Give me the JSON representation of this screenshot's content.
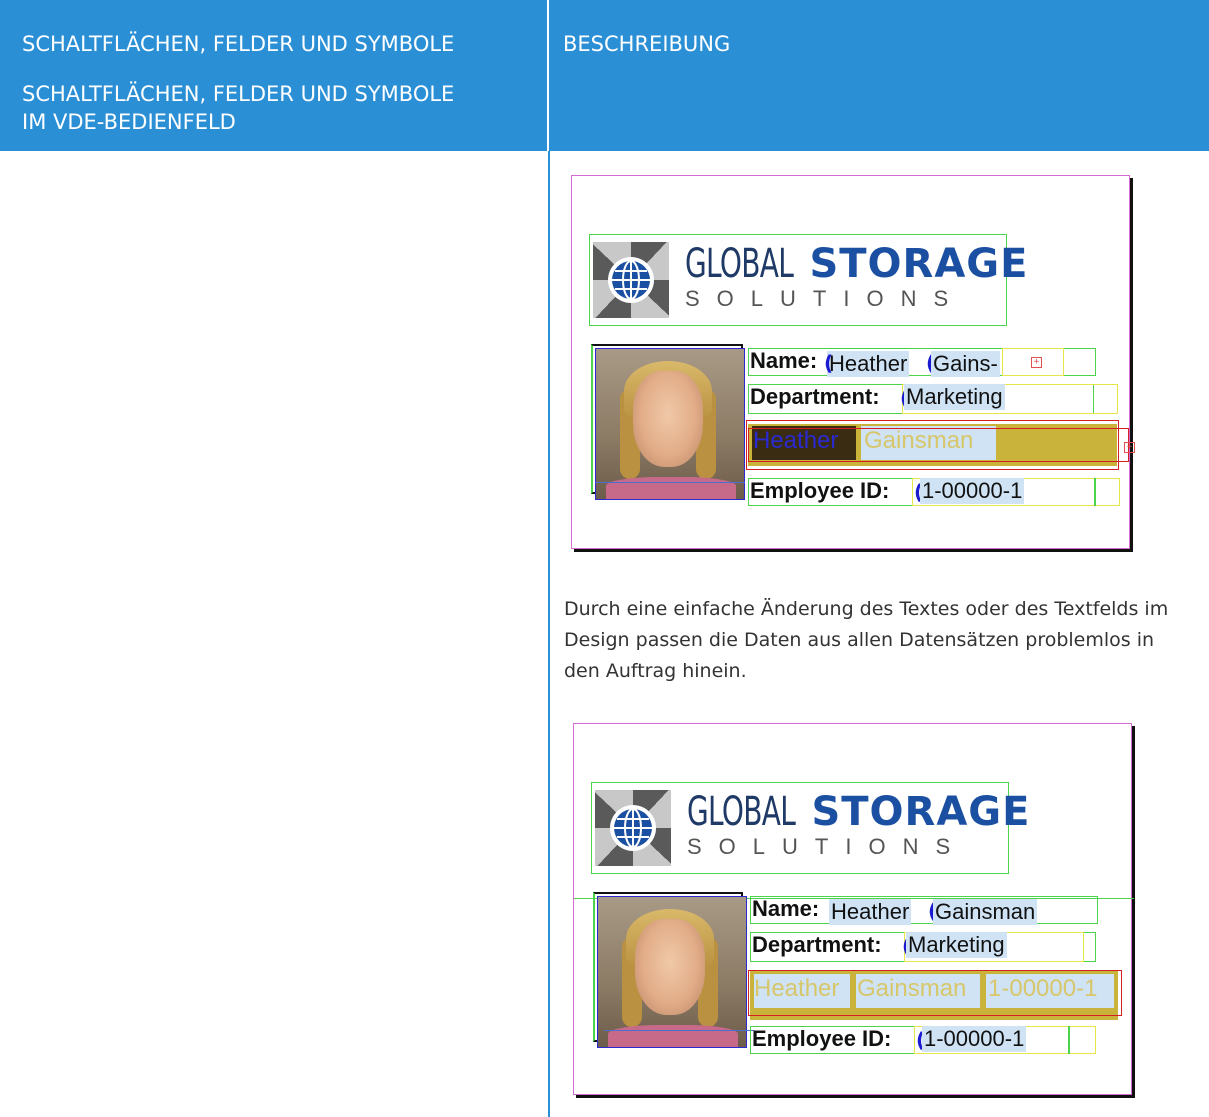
{
  "header": {
    "col1_title": "SCHALTFLÄCHEN, FELDER UND SYMBOLE",
    "col1_subtitle_line1": "SCHALTFLÄCHEN, FELDER UND SYMBOLE",
    "col1_subtitle_line2": "IM VDE-BEDIENFELD",
    "col2_title": "BESCHREIBUNG",
    "background_color": "#2b8fd6"
  },
  "description": "Durch eine einfache Änderung des Textes oder des Textfelds im Design passen die Daten aus allen Datensätzen problemlos in den Auftrag hinein.",
  "card1": {
    "brand_global": "GLOBAL",
    "brand_storage": "STORAGE",
    "brand_solutions": "SOLUTIONS",
    "name_label": "Name:",
    "first_name": "Heather",
    "last_name_fragment": "Gains-",
    "department_label": "Department:",
    "department_value": "Marketing",
    "banner_first": "Heather",
    "banner_last": "Gainsman",
    "employee_label": "Employee ID:",
    "employee_value": "1-00000-1"
  },
  "card2": {
    "brand_global": "GLOBAL",
    "brand_storage": "STORAGE",
    "brand_solutions": "SOLUTIONS",
    "name_label": "Name:",
    "first_name": "Heather",
    "last_name": "Gainsman",
    "department_label": "Department:",
    "department_value": "Marketing",
    "banner_first": "Heather",
    "banner_last": "Gainsman",
    "banner_id": "1-00000-1",
    "employee_label": "Employee ID:",
    "employee_value": "1-00000-1"
  }
}
